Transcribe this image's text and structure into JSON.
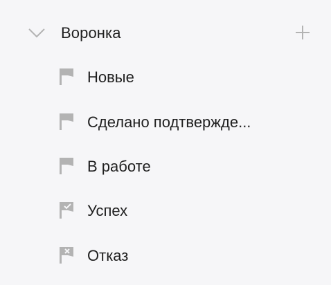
{
  "funnel": {
    "title": "Воронка",
    "collapse_icon": "chevron-down-icon",
    "add_icon": "plus-icon",
    "items": [
      {
        "label": "Новые",
        "icon": "flag-icon"
      },
      {
        "label": "Сделано подтвержде...",
        "icon": "flag-icon"
      },
      {
        "label": "В работе",
        "icon": "flag-icon"
      },
      {
        "label": "Успех",
        "icon": "flag-check-icon"
      },
      {
        "label": "Отказ",
        "icon": "flag-cross-icon"
      }
    ]
  },
  "colors": {
    "background": "#f6f6f8",
    "text": "#1f1f1f",
    "icon": "#b3b3b3"
  }
}
